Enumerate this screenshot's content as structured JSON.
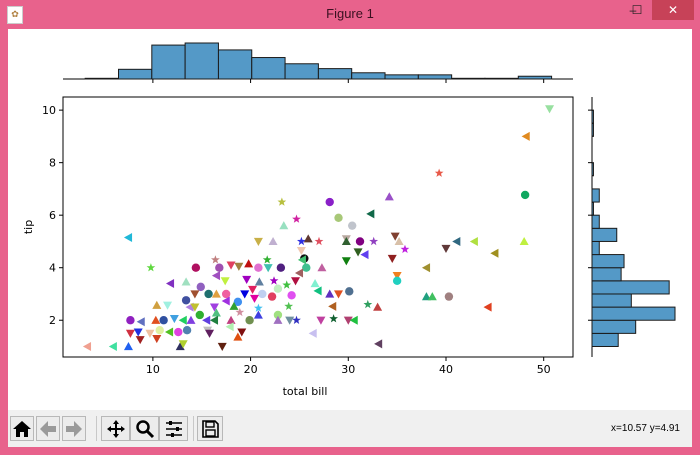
{
  "window": {
    "title": "Figure 1",
    "minimize": "–",
    "maximize": "☐",
    "close": "✕"
  },
  "toolbar": {
    "buttons": [
      {
        "name": "home-button",
        "icon": "home-icon"
      },
      {
        "name": "back-button",
        "icon": "arrow-left-icon"
      },
      {
        "name": "forward-button",
        "icon": "arrow-right-icon"
      },
      {
        "name": "pan-button",
        "icon": "move-icon"
      },
      {
        "name": "zoom-button",
        "icon": "magnifier-icon"
      },
      {
        "name": "configure-subplots-button",
        "icon": "sliders-icon"
      },
      {
        "name": "save-button",
        "icon": "floppy-icon"
      }
    ],
    "coordinates": "x=10.57 y=4.91"
  },
  "chart_data": {
    "type": "scatter",
    "title": "",
    "xlabel": "total bill",
    "ylabel": "tip",
    "xlim": [
      0.8,
      53
    ],
    "ylim": [
      0.6,
      10.5
    ],
    "xticks": [
      10,
      20,
      30,
      40,
      50
    ],
    "yticks": [
      2,
      4,
      6,
      8,
      10
    ],
    "grid": false,
    "points": [
      [
        50.6,
        10.05,
        "v",
        "#98e0a0"
      ],
      [
        48.2,
        9.0,
        "<",
        "#e08a20"
      ],
      [
        39.3,
        7.6,
        "*",
        "#e85a4a"
      ],
      [
        48.1,
        6.77,
        "o",
        "#10a860"
      ],
      [
        34.2,
        6.7,
        "^",
        "#9a50c8"
      ],
      [
        28.1,
        6.5,
        "o",
        "#8a20c8"
      ],
      [
        23.2,
        6.5,
        "*",
        "#b8c040"
      ],
      [
        24.7,
        5.85,
        "*",
        "#d020a0"
      ],
      [
        29.0,
        5.9,
        "o",
        "#a8c878"
      ],
      [
        30.4,
        5.6,
        "o",
        "#c0c4cc"
      ],
      [
        32.3,
        6.05,
        "<",
        "#106848"
      ],
      [
        23.4,
        5.6,
        "^",
        "#98e0c0"
      ],
      [
        7.5,
        5.15,
        "<",
        "#20b8d8"
      ],
      [
        20.8,
        5.0,
        "v",
        "#c8b048"
      ],
      [
        22.3,
        5.0,
        "^",
        "#c0b0d0"
      ],
      [
        25.2,
        5.0,
        "*",
        "#3030e0"
      ],
      [
        25.9,
        5.1,
        "^",
        "#603830"
      ],
      [
        27.0,
        5.0,
        "*",
        "#e05060"
      ],
      [
        29.8,
        5.1,
        "v",
        "#b8a8a0"
      ],
      [
        29.8,
        5.0,
        "^",
        "#306030"
      ],
      [
        31.2,
        5.0,
        "o",
        "#800080"
      ],
      [
        32.6,
        5.0,
        "*",
        "#9040c0"
      ],
      [
        34.8,
        5.2,
        "v",
        "#804030"
      ],
      [
        35.2,
        5.0,
        "^",
        "#d8c0a8"
      ],
      [
        35.8,
        4.7,
        "*",
        "#c020e0"
      ],
      [
        31.7,
        4.5,
        "<",
        "#6040f0"
      ],
      [
        40.0,
        4.73,
        "v",
        "#603838"
      ],
      [
        41.1,
        5.0,
        "<",
        "#306880"
      ],
      [
        42.9,
        5.0,
        "<",
        "#b0e040"
      ],
      [
        48.0,
        5.0,
        "^",
        "#c0f040"
      ],
      [
        25.2,
        4.65,
        "v",
        "#f0c8b0"
      ],
      [
        25.5,
        4.35,
        "o",
        "#101010"
      ],
      [
        25.3,
        4.3,
        "<",
        "#40c070"
      ],
      [
        29.8,
        4.26,
        "v",
        "#108010"
      ],
      [
        21.7,
        4.3,
        "*",
        "#30b030"
      ],
      [
        16.4,
        4.3,
        "*",
        "#c08080"
      ],
      [
        9.8,
        4.0,
        "*",
        "#60d840"
      ],
      [
        14.4,
        4.0,
        "o",
        "#b01060"
      ],
      [
        16.8,
        4.0,
        "o",
        "#a050b0"
      ],
      [
        18.0,
        4.1,
        "v",
        "#e04060"
      ],
      [
        18.8,
        4.05,
        "v",
        "#a08040"
      ],
      [
        19.8,
        4.15,
        "^",
        "#c01010"
      ],
      [
        20.8,
        4.0,
        "o",
        "#e070d0"
      ],
      [
        21.8,
        4.0,
        "v",
        "#40c0b0"
      ],
      [
        23.1,
        4.0,
        "o",
        "#502080"
      ],
      [
        25.7,
        4.0,
        "o",
        "#40c090"
      ],
      [
        27.3,
        4.0,
        "^",
        "#c060a0"
      ],
      [
        16.5,
        3.7,
        "<",
        "#a050c0"
      ],
      [
        11.8,
        3.4,
        "<",
        "#8030c0"
      ],
      [
        13.4,
        3.46,
        "^",
        "#a0e0c0"
      ],
      [
        14.9,
        3.27,
        "o",
        "#9060c0"
      ],
      [
        17.4,
        3.5,
        "v",
        "#c0f040"
      ],
      [
        19.6,
        3.55,
        "v",
        "#a000c0"
      ],
      [
        20.9,
        3.46,
        "^",
        "#6080a0"
      ],
      [
        22.4,
        3.5,
        "*",
        "#a000c0"
      ],
      [
        24.6,
        3.5,
        "v",
        "#b01040"
      ],
      [
        25.0,
        3.8,
        "<",
        "#a06060"
      ],
      [
        23.7,
        3.34,
        "*",
        "#40c040"
      ],
      [
        26.6,
        3.4,
        "^",
        "#80f0d0"
      ],
      [
        26.9,
        3.12,
        "<",
        "#10c080"
      ],
      [
        28.1,
        3.0,
        "^",
        "#6030c0"
      ],
      [
        29.0,
        3.0,
        "v",
        "#e05020"
      ],
      [
        30.1,
        3.1,
        "o",
        "#507090"
      ],
      [
        14.3,
        3.0,
        "v",
        "#a05030"
      ],
      [
        15.7,
        3.0,
        "o",
        "#207070"
      ],
      [
        16.5,
        3.0,
        "^",
        "#e0a040"
      ],
      [
        17.5,
        3.0,
        "o",
        "#f060a0"
      ],
      [
        19.4,
        3.0,
        "v",
        "#0000e0"
      ],
      [
        20.2,
        3.17,
        "v",
        "#e02060"
      ],
      [
        21.2,
        3.0,
        "o",
        "#c0d0f0"
      ],
      [
        22.8,
        3.2,
        "o",
        "#c0f0c0"
      ],
      [
        24.2,
        2.95,
        "o",
        "#e050f0"
      ],
      [
        22.2,
        2.9,
        "o",
        "#e04060"
      ],
      [
        20.4,
        2.83,
        "v",
        "#e000a0"
      ],
      [
        17.5,
        2.73,
        "<",
        "#a030e0"
      ],
      [
        18.7,
        2.7,
        "o",
        "#4090f0"
      ],
      [
        10.4,
        2.57,
        "^",
        "#d0a040"
      ],
      [
        11.5,
        2.57,
        "v",
        "#a0f0e0"
      ],
      [
        13.4,
        2.76,
        "o",
        "#4050a0"
      ],
      [
        13.8,
        2.5,
        "<",
        "#b080e0"
      ],
      [
        14.3,
        2.5,
        "v",
        "#c0c030"
      ],
      [
        16.3,
        2.5,
        "v",
        "#a040e0"
      ],
      [
        16.5,
        2.28,
        "^",
        "#50c080"
      ],
      [
        18.3,
        2.53,
        "^",
        "#30a030"
      ],
      [
        18.9,
        2.3,
        "*",
        "#d090a0"
      ],
      [
        20.8,
        2.46,
        "*",
        "#40c0f0"
      ],
      [
        20.8,
        2.2,
        "^",
        "#4040e0"
      ],
      [
        22.8,
        2.2,
        "o",
        "#a0e080"
      ],
      [
        23.9,
        2.53,
        "*",
        "#50c050"
      ],
      [
        28.4,
        2.53,
        "<",
        "#b06020"
      ],
      [
        7.7,
        2.0,
        "o",
        "#9020c0"
      ],
      [
        8.8,
        1.94,
        "<",
        "#6070c0"
      ],
      [
        10.3,
        2.0,
        "^",
        "#e05020"
      ],
      [
        11.1,
        2.0,
        "o",
        "#3050a0"
      ],
      [
        12.2,
        2.06,
        "v",
        "#40a0e0"
      ],
      [
        13.1,
        2.0,
        "<",
        "#20d060"
      ],
      [
        13.9,
        2.0,
        "^",
        "#8040e0"
      ],
      [
        14.8,
        2.2,
        "o",
        "#30b030"
      ],
      [
        15.5,
        2.0,
        "<",
        "#6040e0"
      ],
      [
        16.3,
        2.0,
        "<",
        "#208040"
      ],
      [
        18.0,
        2.0,
        "^",
        "#c04080"
      ],
      [
        19.9,
        2.0,
        "o",
        "#709050"
      ],
      [
        22.8,
        2.0,
        "^",
        "#a070c0"
      ],
      [
        24.0,
        2.0,
        "v",
        "#7090a0"
      ],
      [
        24.7,
        2.0,
        "*",
        "#3030c0"
      ],
      [
        27.2,
        2.0,
        "v",
        "#c040a0"
      ],
      [
        28.5,
        2.06,
        "*",
        "#106030"
      ],
      [
        30.0,
        2.0,
        "v",
        "#b04070"
      ],
      [
        30.6,
        2.0,
        "<",
        "#20c040"
      ],
      [
        7.7,
        1.5,
        "v",
        "#d03040"
      ],
      [
        8.5,
        1.55,
        "v",
        "#2030e0"
      ],
      [
        8.7,
        1.26,
        "v",
        "#a02020"
      ],
      [
        9.7,
        1.5,
        "v",
        "#f0c0a0"
      ],
      [
        10.4,
        1.3,
        "v",
        "#d04020"
      ],
      [
        10.7,
        1.62,
        "o",
        "#e0f0a0"
      ],
      [
        11.7,
        1.55,
        "<",
        "#50c020"
      ],
      [
        12.6,
        1.55,
        "o",
        "#e040e0"
      ],
      [
        13.5,
        1.62,
        "o",
        "#5080b0"
      ],
      [
        15.6,
        1.62,
        "v",
        "#c0c0c0"
      ],
      [
        15.8,
        1.5,
        "v",
        "#602060"
      ],
      [
        17.9,
        1.75,
        "<",
        "#b0f0b0"
      ],
      [
        19.1,
        1.55,
        "v",
        "#801010"
      ],
      [
        18.7,
        1.36,
        "^",
        "#e05010"
      ],
      [
        26.4,
        1.5,
        "<",
        "#c8c0f0"
      ],
      [
        3.3,
        1.0,
        "<",
        "#f0a090"
      ],
      [
        5.95,
        1.0,
        "<",
        "#40e0a0"
      ],
      [
        7.5,
        1.0,
        "^",
        "#2060f0"
      ],
      [
        12.8,
        1.0,
        "^",
        "#303060"
      ],
      [
        13.1,
        1.1,
        "v",
        "#b0d030"
      ],
      [
        17.1,
        1.0,
        "v",
        "#602010"
      ],
      [
        33.1,
        1.1,
        "<",
        "#604060"
      ],
      [
        35.0,
        3.7,
        "v",
        "#f08020"
      ],
      [
        35.0,
        3.5,
        "o",
        "#20d0c0"
      ],
      [
        38.0,
        2.9,
        "^",
        "#20a080"
      ],
      [
        38.6,
        2.9,
        "^",
        "#40c060"
      ],
      [
        40.3,
        2.9,
        "o",
        "#a08080"
      ],
      [
        44.3,
        2.5,
        "<",
        "#e04020"
      ],
      [
        38.0,
        4.0,
        "<",
        "#a09030"
      ],
      [
        45.0,
        4.55,
        "<",
        "#a09020"
      ],
      [
        32.0,
        2.6,
        "*",
        "#30a060"
      ],
      [
        33.0,
        2.5,
        "^",
        "#c04040"
      ],
      [
        31.0,
        4.6,
        "v",
        "#306020"
      ],
      [
        34.5,
        4.35,
        "v",
        "#902020"
      ]
    ],
    "marginal_x": {
      "bin_edges_start": 3.07,
      "bin_width": 3.41,
      "counts": [
        1,
        14,
        49,
        52,
        42,
        31,
        22,
        15,
        9,
        6,
        6,
        1,
        1,
        4
      ]
    },
    "marginal_y": {
      "bin_edges_start": 1.0,
      "bin_width": 0.5,
      "counts": [
        18,
        30,
        57,
        27,
        53,
        20,
        22,
        5,
        17,
        5,
        1,
        5,
        0,
        1,
        0,
        0,
        1,
        1
      ]
    },
    "colors": {
      "hist_fill": "#5499c7",
      "hist_edge": "#1a1a1a"
    }
  }
}
